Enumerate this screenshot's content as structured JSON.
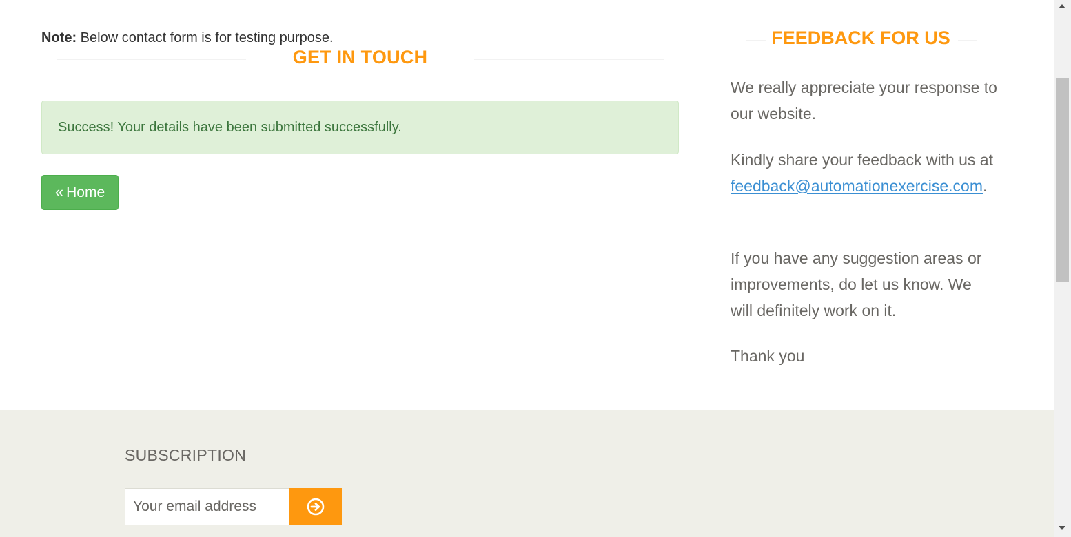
{
  "contact": {
    "note_label": "Note:",
    "note_text": " Below contact form is for testing purpose.",
    "title": "GET IN TOUCH",
    "success_message": "Success! Your details have been submitted successfully.",
    "home_button_icon": "«",
    "home_button_label": "Home"
  },
  "feedback": {
    "title": "FEEDBACK FOR US",
    "para1": "We really appreciate your response to our website.",
    "para2_prefix": "Kindly share your feedback with us at",
    "email": "feedback@automationexercise.com",
    "para2_suffix": ".",
    "para3": "If you have any suggestion areas or improvements, do let us know. We will definitely work on it.",
    "para4": "Thank you"
  },
  "footer": {
    "subscription_title": "SUBSCRIPTION",
    "email_placeholder": "Your email address",
    "subscribe_icon": "arrow-circle-right-icon"
  },
  "colors": {
    "accent": "#fe980f",
    "success_bg": "#dff0d8",
    "success_text": "#3c763d",
    "home_button": "#5cb85c",
    "footer_bg": "#efefe8",
    "link": "#3b8fd3"
  }
}
